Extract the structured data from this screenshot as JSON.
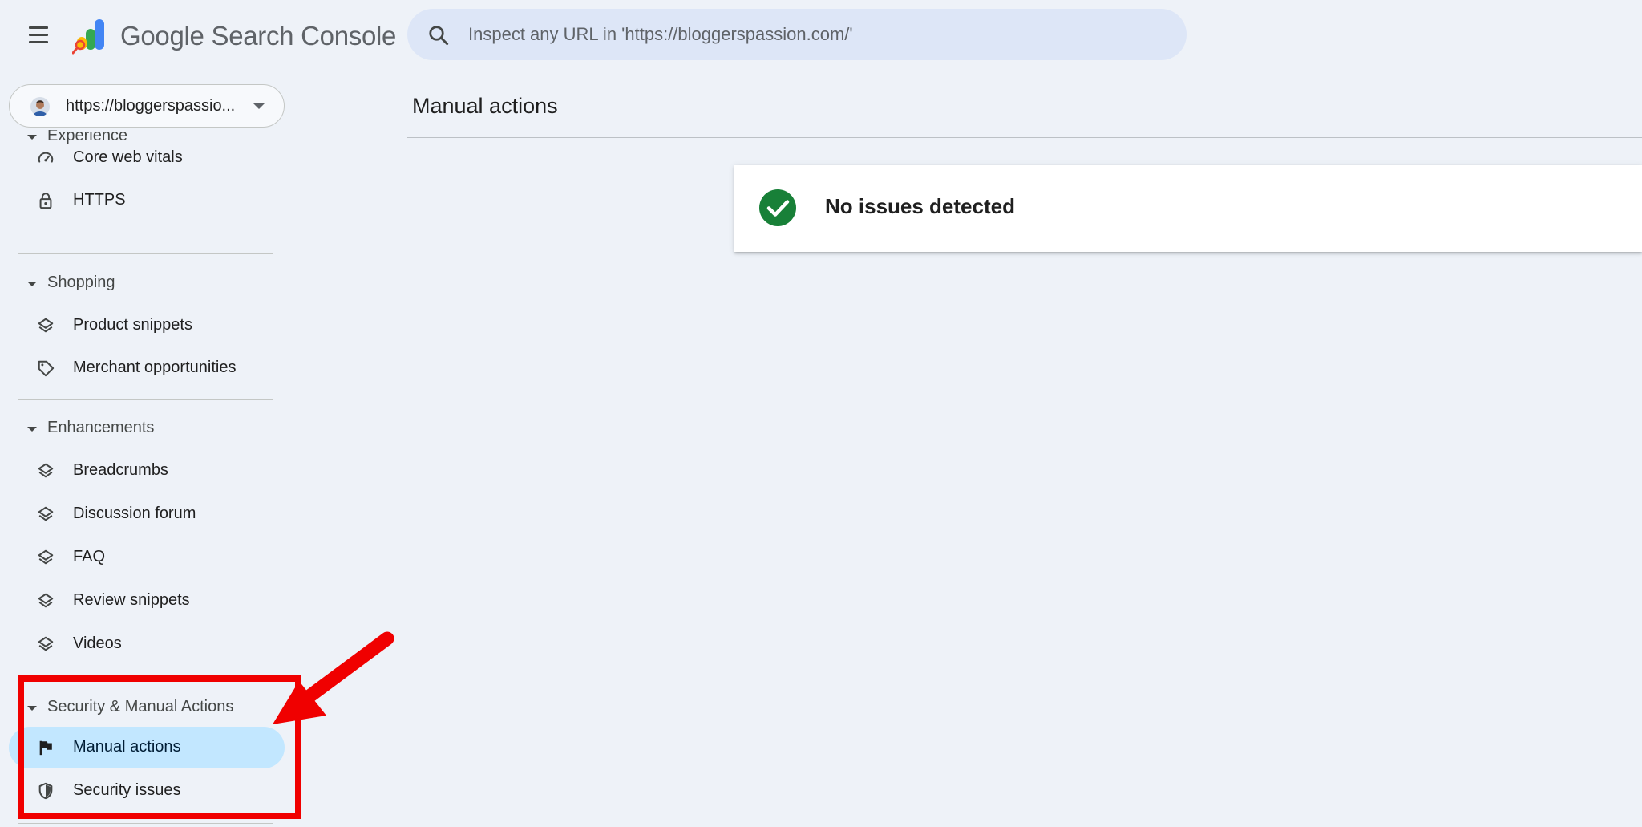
{
  "header": {
    "app_name": "Google Search Console",
    "search_placeholder": "Inspect any URL in 'https://bloggerspassion.com/'"
  },
  "property": {
    "label": "https://bloggerspassio..."
  },
  "sidebar": {
    "partial_section": "Experience",
    "experience_items": [
      {
        "label": "Core web vitals",
        "icon": "speedometer-icon"
      },
      {
        "label": "HTTPS",
        "icon": "lock-icon"
      }
    ],
    "shopping": {
      "title": "Shopping",
      "items": [
        {
          "label": "Product snippets",
          "icon": "layers-icon"
        },
        {
          "label": "Merchant opportunities",
          "icon": "tag-icon"
        }
      ]
    },
    "enhancements": {
      "title": "Enhancements",
      "items": [
        {
          "label": "Breadcrumbs",
          "icon": "layers-icon"
        },
        {
          "label": "Discussion forum",
          "icon": "layers-icon"
        },
        {
          "label": "FAQ",
          "icon": "layers-icon"
        },
        {
          "label": "Review snippets",
          "icon": "layers-icon"
        },
        {
          "label": "Videos",
          "icon": "layers-icon"
        }
      ]
    },
    "security": {
      "title": "Security & Manual Actions",
      "items": [
        {
          "label": "Manual actions",
          "icon": "flag-icon",
          "active": true
        },
        {
          "label": "Security issues",
          "icon": "shield-icon"
        }
      ]
    }
  },
  "main": {
    "title": "Manual actions",
    "status_text": "No issues detected"
  },
  "colors": {
    "background": "#eef2f8",
    "active_item": "#c2e7ff",
    "success_green": "#188038",
    "annotation_red": "#f00000"
  }
}
